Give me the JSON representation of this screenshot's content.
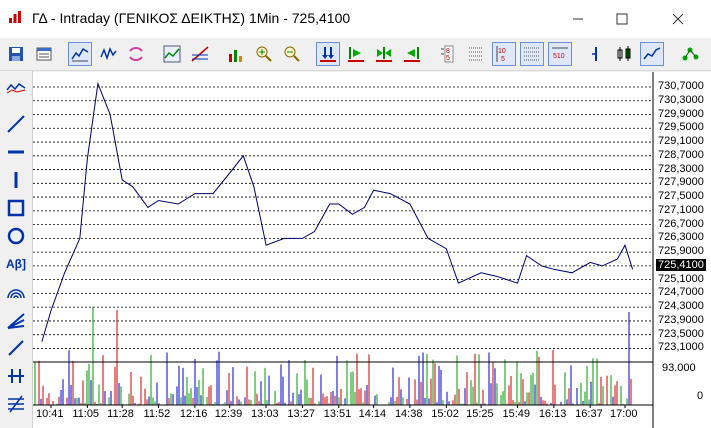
{
  "window": {
    "title": "ΓΔ - Intraday (ΓΕΝΙΚΟΣ ΔΕΙΚΤΗΣ) 1Min - 725,4100",
    "minimize_icon": "minimize-icon",
    "maximize_icon": "maximize-icon",
    "close_icon": "close-icon"
  },
  "toolbar": {
    "items": [
      "save-icon",
      "properties-icon",
      "line-chart-icon",
      "candle-icon",
      "compare-icon",
      "indicator-icon",
      "trendline-icon",
      "volume-icon",
      "zoom-in-icon",
      "zoom-out-icon",
      "fit-icon",
      "play-icon",
      "step-icon",
      "back-icon",
      "levels-icon",
      "grid-icon",
      "ladder-icon",
      "scale-icon",
      "bar-icon",
      "ohlc-icon",
      "line-icon",
      "network-icon"
    ]
  },
  "sidebar": {
    "items": [
      "indicator-icon",
      "diagonal-line-icon",
      "horizontal-line-icon",
      "vertical-line-icon",
      "rectangle-icon",
      "ellipse-icon",
      "text-icon",
      "arc-icon",
      "fan-icon",
      "ray-icon",
      "cross-icon",
      "fibonacci-icon"
    ],
    "text_tool_label": "Aβ]"
  },
  "colors": {
    "price_line": "#00006e",
    "vol_red": "#cc0000",
    "vol_blue": "#0000cc",
    "vol_green": "#009900",
    "accent": "#6b8fd6"
  },
  "chart_data": {
    "type": "line",
    "price_axis_labels": [
      "730,7000",
      "730,3000",
      "729,9000",
      "729,5000",
      "729,1000",
      "728,7000",
      "728,3000",
      "727,9000",
      "727,5000",
      "727,1000",
      "726,7000",
      "726,3000",
      "725,9000",
      "725,4100",
      "725,1000",
      "724,7000",
      "724,3000",
      "723,9000",
      "723,5000",
      "723,1000"
    ],
    "current_value": "725,4100",
    "volume_axis_labels": [
      "93.000",
      "0"
    ],
    "x_tick_labels": [
      "10:41",
      "11:05",
      "11:28",
      "11:52",
      "12:16",
      "12:39",
      "13:03",
      "13:27",
      "13:51",
      "14:14",
      "14:38",
      "15:02",
      "15:25",
      "15:49",
      "16:13",
      "16:37",
      "17:00"
    ],
    "x": [
      "10:35",
      "10:41",
      "10:50",
      "11:00",
      "11:05",
      "11:12",
      "11:20",
      "11:28",
      "11:35",
      "11:45",
      "11:52",
      "12:05",
      "12:16",
      "12:28",
      "12:39",
      "12:48",
      "12:55",
      "13:03",
      "13:15",
      "13:27",
      "13:35",
      "13:45",
      "13:51",
      "14:00",
      "14:08",
      "14:14",
      "14:25",
      "14:38",
      "14:50",
      "15:02",
      "15:10",
      "15:25",
      "15:35",
      "15:49",
      "15:55",
      "16:05",
      "16:13",
      "16:25",
      "16:37",
      "16:45",
      "16:55",
      "17:00",
      "17:05"
    ],
    "series": [
      {
        "values": [
          723.3,
          724.2,
          725.3,
          726.3,
          728.6,
          730.8,
          729.9,
          728.0,
          727.8,
          727.2,
          727.4,
          727.3,
          727.6,
          727.6,
          728.2,
          728.7,
          727.8,
          726.1,
          726.3,
          726.3,
          726.5,
          727.3,
          727.3,
          727.0,
          727.2,
          727.7,
          727.6,
          727.3,
          726.3,
          726.0,
          725.0,
          725.3,
          725.2,
          725.0,
          725.8,
          725.5,
          725.4,
          725.3,
          725.6,
          725.5,
          725.7,
          726.1,
          725.4
        ]
      }
    ],
    "volume_max": 93000,
    "volume_min": 0
  }
}
